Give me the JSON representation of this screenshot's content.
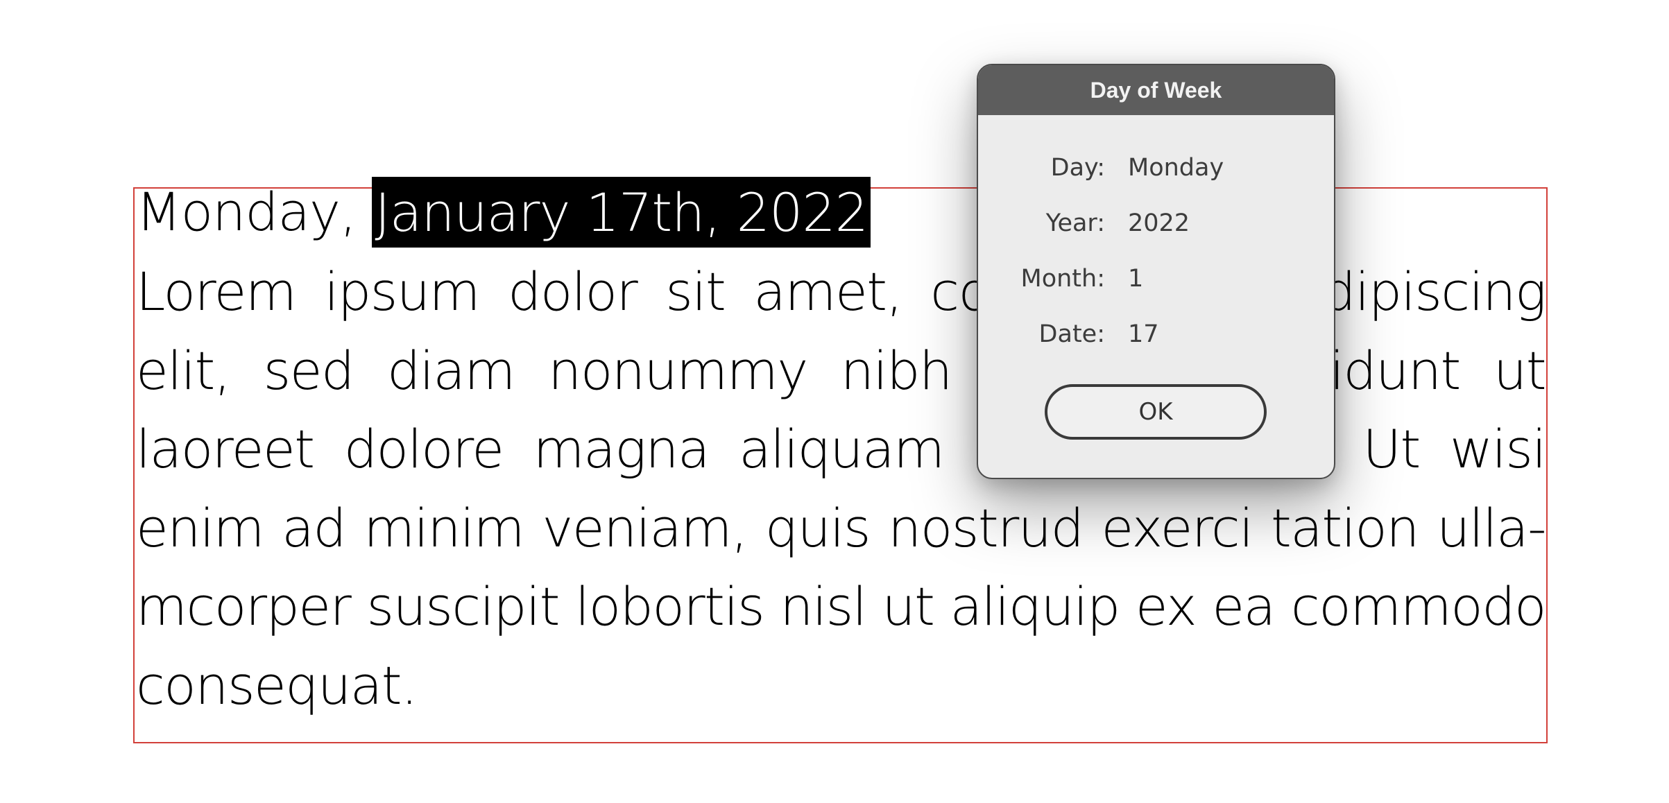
{
  "document": {
    "date_prefix": "Monday, ",
    "date_selected": "January 17th, 2022",
    "body_lines": [
      "Lorem ipsum dolor sit amet, consectetuer adipiscing",
      "elit, sed diam nonummy nibh euismod tincidunt ut",
      "laoreet dolore magna aliquam erat volutpat. Ut wisi",
      "enim ad minim veniam, quis nostrud exerci tation ulla-",
      "mcorper suscipit lobortis nisl ut aliquip ex ea commodo",
      "consequat."
    ],
    "frame_color": "#d2403a",
    "selection_color": "#000000"
  },
  "dialog": {
    "title": "Day of Week",
    "fields": [
      {
        "label": "Day:",
        "value": "Monday"
      },
      {
        "label": "Year:",
        "value": "2022"
      },
      {
        "label": "Month:",
        "value": "1"
      },
      {
        "label": "Date:",
        "value": "17"
      }
    ],
    "ok_label": "OK",
    "titlebar_color": "#5d5d5d"
  }
}
